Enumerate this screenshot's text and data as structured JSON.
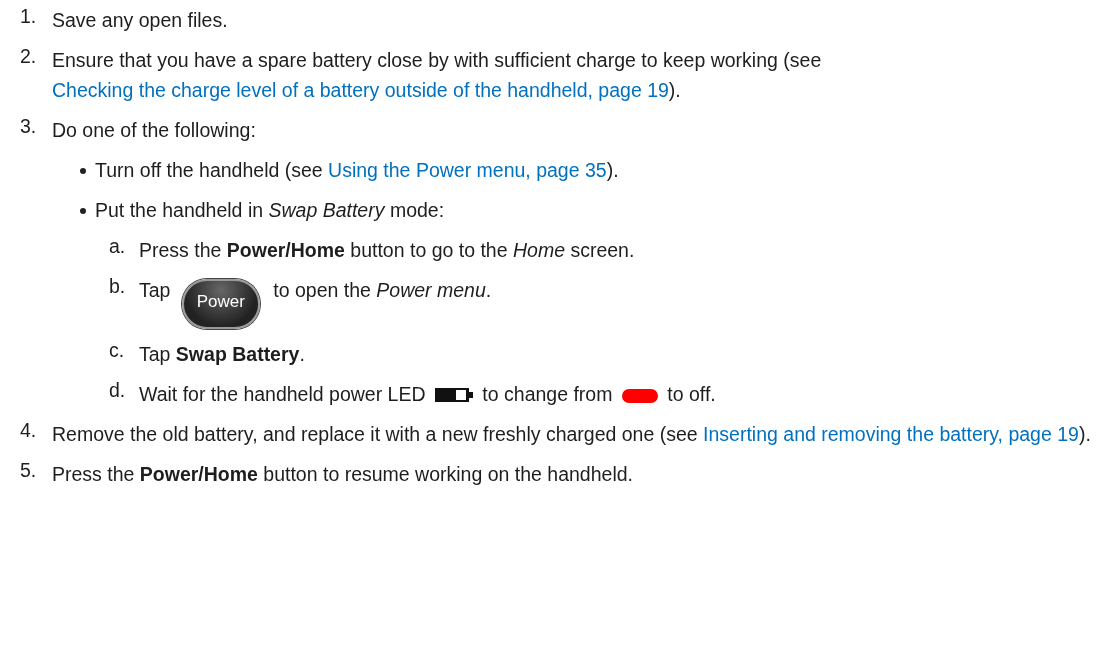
{
  "steps": [
    {
      "number": "1.",
      "segments": [
        {
          "kind": "text",
          "text": "Save any open files."
        }
      ]
    },
    {
      "number": "2.",
      "segments": [
        {
          "kind": "text",
          "text": "Ensure that you have a spare battery close by with sufficient charge to keep working (see "
        },
        {
          "kind": "link",
          "text": "Checking the charge level of a battery outside of the handheld, page 19"
        },
        {
          "kind": "text",
          "text": ")."
        }
      ]
    },
    {
      "number": "3.",
      "segments": [
        {
          "kind": "text",
          "text": "Do one of the following:"
        }
      ],
      "children": [
        {
          "segments": [
            {
              "kind": "text",
              "text": "Turn off the handheld (see "
            },
            {
              "kind": "link",
              "text": "Using the Power menu, page 35"
            },
            {
              "kind": "text",
              "text": ")."
            }
          ]
        },
        {
          "segments": [
            {
              "kind": "text",
              "text": "Put the handheld in *Swap Battery* mode:"
            }
          ],
          "children": [
            {
              "number": "a.",
              "segments": [
                {
                  "kind": "text",
                  "text": "Press the **Power/Home** button to go to the *Home* screen."
                }
              ]
            },
            {
              "number": "b.",
              "segments": [
                {
                  "kind": "text",
                  "text": "Tap "
                },
                {
                  "kind": "power-button",
                  "text": "Power"
                },
                {
                  "kind": "text",
                  "text": " to open the *Power menu*."
                }
              ]
            },
            {
              "number": "c.",
              "segments": [
                {
                  "kind": "text",
                  "text": "Tap **Swap Battery**."
                }
              ]
            },
            {
              "number": "d.",
              "segments": [
                {
                  "kind": "text",
                  "text": "Wait for the handheld power LED "
                },
                {
                  "kind": "led-icon"
                },
                {
                  "kind": "text",
                  "text": " to change from "
                },
                {
                  "kind": "red-led-icon"
                },
                {
                  "kind": "text",
                  "text": " to off."
                }
              ]
            }
          ]
        }
      ]
    },
    {
      "number": "4.",
      "segments": [
        {
          "kind": "text",
          "text": "Remove the old battery, and replace it with a new freshly charged one (see "
        },
        {
          "kind": "link",
          "text": "Inserting and removing the battery, page 19"
        },
        {
          "kind": "text",
          "text": ")."
        }
      ]
    },
    {
      "number": "5.",
      "segments": [
        {
          "kind": "text",
          "text": "Press the **Power/Home** button to resume working on the handheld."
        }
      ]
    }
  ]
}
